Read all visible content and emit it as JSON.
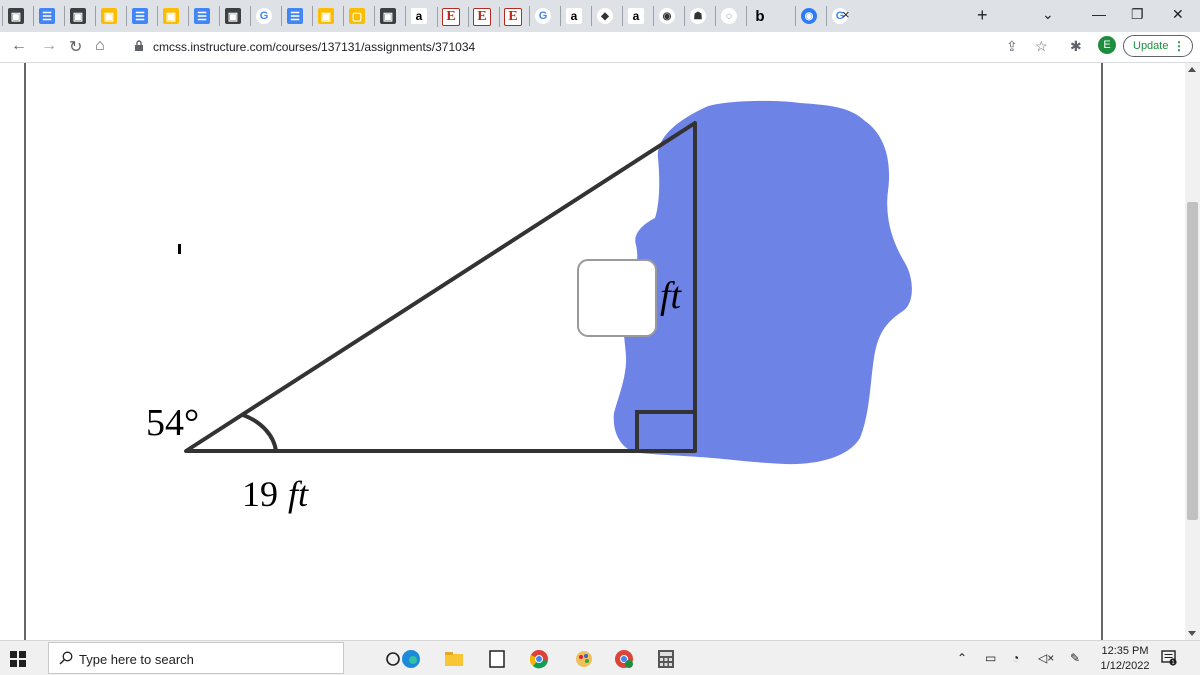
{
  "browser": {
    "tabs": [
      {
        "icon": "classroom-icon",
        "glyph": "▣"
      },
      {
        "icon": "docs-icon",
        "glyph": "☰"
      },
      {
        "icon": "classroom-icon",
        "glyph": "▣"
      },
      {
        "icon": "slides-icon",
        "glyph": "▣"
      },
      {
        "icon": "docs-icon",
        "glyph": "☰"
      },
      {
        "icon": "slides-icon",
        "glyph": "▣"
      },
      {
        "icon": "docs-icon",
        "glyph": "☰"
      },
      {
        "icon": "classroom-icon",
        "glyph": "▣"
      },
      {
        "icon": "google-icon",
        "glyph": "G"
      },
      {
        "icon": "docs-icon",
        "glyph": "☰"
      },
      {
        "icon": "slides-icon",
        "glyph": "▣"
      },
      {
        "icon": "keep-icon",
        "glyph": "▢"
      },
      {
        "icon": "classroom-icon",
        "glyph": "▣"
      },
      {
        "icon": "amazon-icon",
        "glyph": "a"
      },
      {
        "icon": "e-icon",
        "glyph": "E"
      },
      {
        "icon": "e-icon",
        "glyph": "E"
      },
      {
        "icon": "e-icon",
        "glyph": "E"
      },
      {
        "icon": "google-icon",
        "glyph": "G"
      },
      {
        "icon": "amazon-icon",
        "glyph": "a"
      },
      {
        "icon": "extension-icon",
        "glyph": "◆"
      },
      {
        "icon": "amazon-icon",
        "glyph": "a"
      },
      {
        "icon": "shield-icon",
        "glyph": "◉"
      },
      {
        "icon": "graduation-cap-icon",
        "glyph": "☗"
      },
      {
        "icon": "circle-icon",
        "glyph": "◌"
      },
      {
        "icon": "bing-icon",
        "glyph": "b"
      },
      {
        "icon": "blue-circle-icon",
        "glyph": "◉"
      },
      {
        "icon": "google-icon",
        "glyph": "G"
      }
    ],
    "active_tab_close": "×",
    "new_tab": "+",
    "url": "cmcss.instructure.com/courses/137131/assignments/371034",
    "profile_initial": "E",
    "update_label": "Update",
    "update_menu": "⋮",
    "tab_search": "⌄",
    "minimize": "—",
    "restore": "❐",
    "close": "✕"
  },
  "problem": {
    "angle_label": "54°",
    "base_label": "19",
    "base_unit": "ft",
    "answer_unit": "ft",
    "answer_value": ""
  },
  "taskbar": {
    "search_placeholder": "Type here to search",
    "time": "12:35 PM",
    "date": "1/12/2022",
    "notification_count": "1"
  },
  "colors": {
    "blob": "#6e83e6",
    "triangle_stroke": "#333333"
  }
}
